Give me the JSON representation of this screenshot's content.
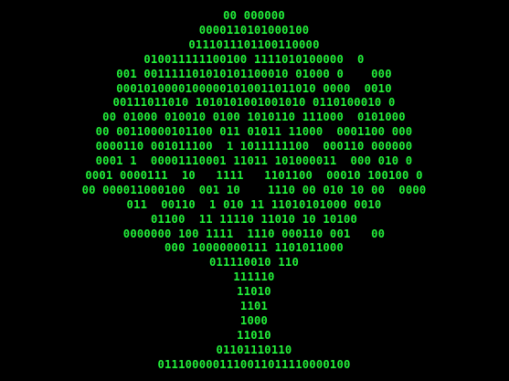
{
  "art": {
    "color": "#22f23a",
    "background": "#000000",
    "lines": [
      "00 000000",
      "0000110101000100",
      "0111011101100110000",
      "010011111100100 1111010100000  0",
      "001 001111101010101100010 01000 0    000",
      "00010100001000001010011011010 0000  0010",
      "00111011010 1010101001001010 0110100010 0",
      "00 01000 010010 0100 1010110 111000  0101000",
      "00 00110000101100 011 01011 11000  0001100 000",
      "0000110 001011100  1 1011111100  000110 000000",
      "0001 1  00001110001 11011 101000011  000 010 0",
      "0001 0000111  10   1111   1101100  00010 100100 0",
      "00 000011000100  001 10    1110 00 010 10 00  0000",
      "011  00110  1 010 11 11010101000 0010",
      "01100  11 11110 11010 10 10100",
      "0000000 100 1111  1110 000110 001   00",
      "000 10000000111 1101011000",
      "011110010 110",
      "111110",
      "11010",
      "1101",
      "1000",
      "11010",
      "01101110110",
      "0111000001110011011110000100"
    ]
  }
}
